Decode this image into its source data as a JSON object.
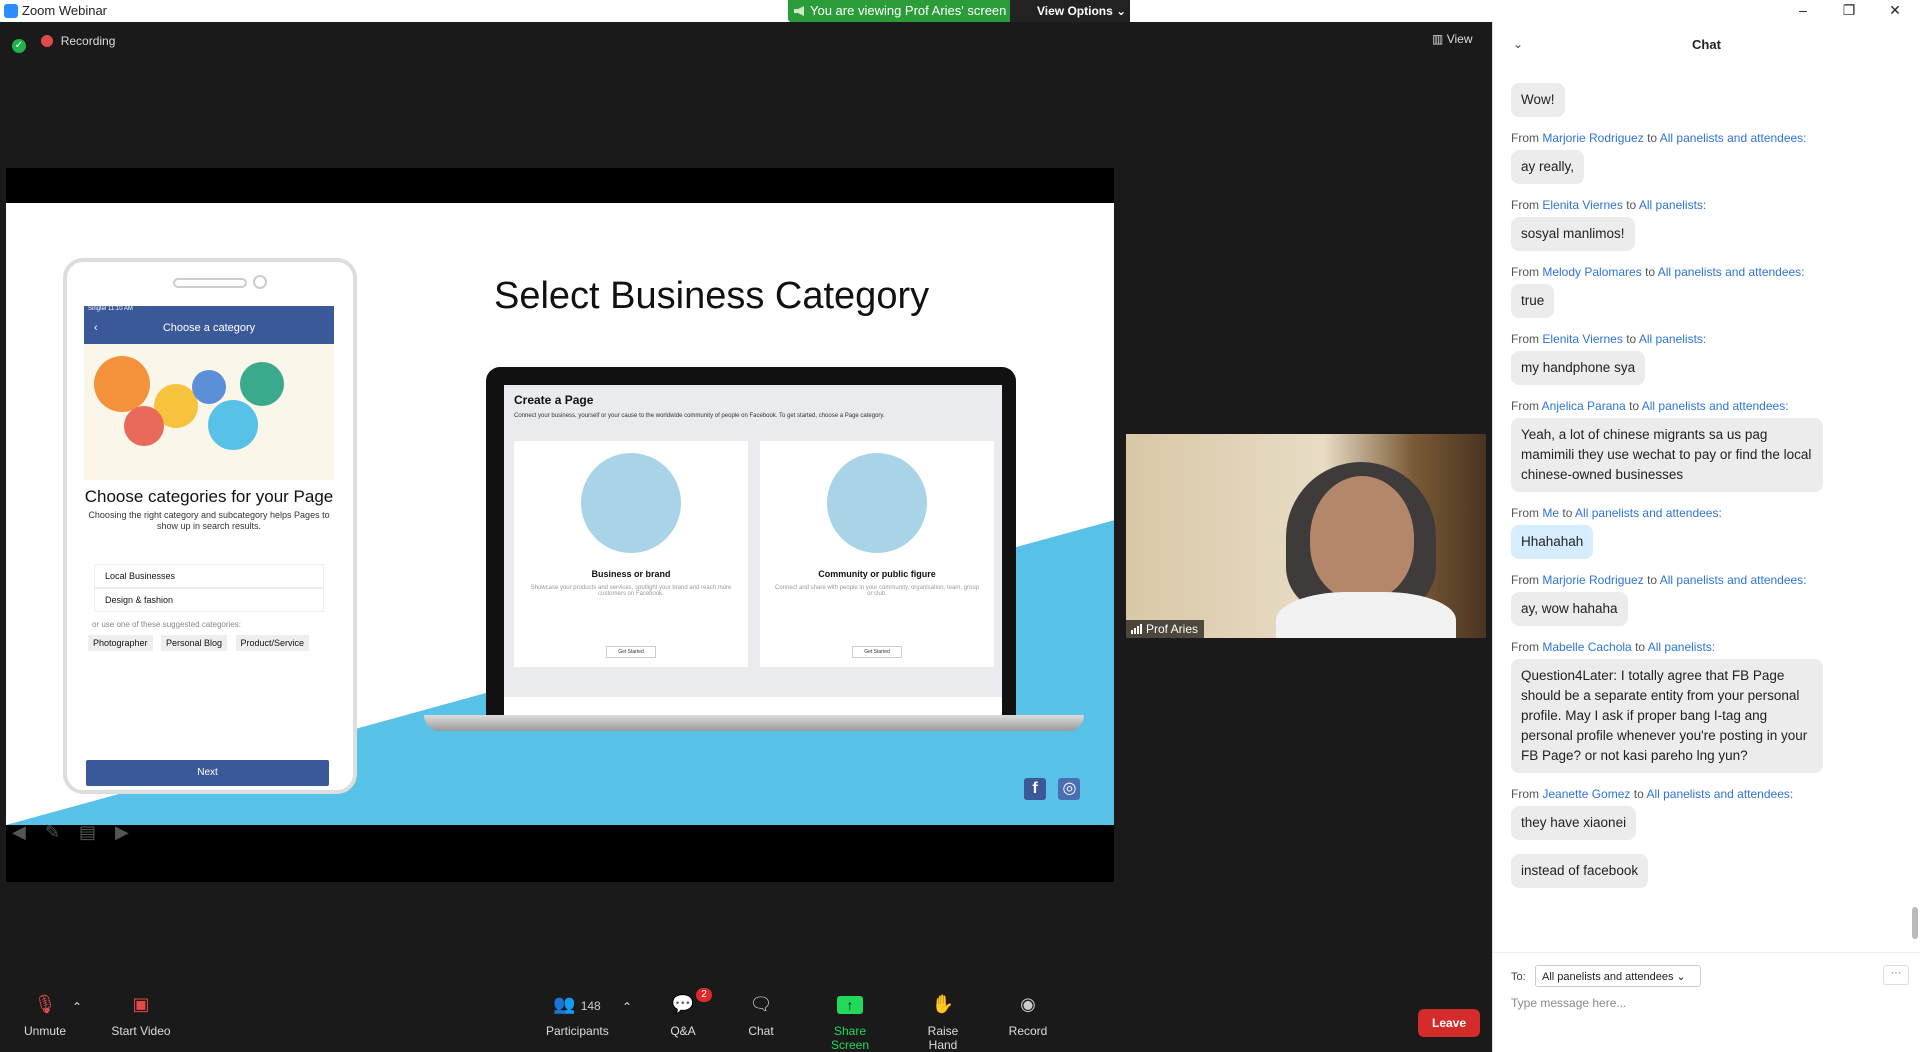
{
  "window": {
    "title": "Zoom Webinar",
    "viewing_banner": "You are viewing Prof Aries' screen",
    "view_options": "View Options",
    "minimize": "–",
    "maximize": "❐",
    "close": "✕"
  },
  "stage": {
    "recording": "Recording",
    "view": "View"
  },
  "slide": {
    "title": "Select Business Category",
    "phone": {
      "status": "Singtel 11:10 AM",
      "header": "Choose a category",
      "back": "‹",
      "heading": "Choose categories for your Page",
      "subtext": "Choosing the right category and subcategory helps Pages to show up in search results.",
      "options": [
        "Local Businesses",
        "Design & fashion"
      ],
      "suggest_label": "or use one of these suggested categories:",
      "chips": [
        "Photographer",
        "Personal Blog",
        "Product/Service"
      ],
      "next": "Next"
    },
    "laptop": {
      "title": "Create a Page",
      "subtitle": "Connect your business, yourself or your cause to the worldwide community of people on Facebook. To get started, choose a Page category.",
      "cards": [
        {
          "title": "Business or brand",
          "desc": "Showcase your products and services, spotlight your brand and reach more customers on Facebook.",
          "button": "Get Started"
        },
        {
          "title": "Community or public figure",
          "desc": "Connect and share with people in your community, organisation, team, group or club.",
          "button": "Get Started"
        }
      ]
    },
    "social": [
      "f",
      "◎"
    ]
  },
  "video": {
    "name": "Prof Aries"
  },
  "toolbar": {
    "unmute": "Unmute",
    "start_video": "Start Video",
    "participants_count": "148",
    "participants": "Participants",
    "qa_badge": "2",
    "qa": "Q&A",
    "chat": "Chat",
    "share_screen": "Share Screen",
    "raise_hand": "Raise Hand",
    "record": "Record",
    "leave": "Leave"
  },
  "chat": {
    "title": "Chat",
    "messages": [
      {
        "text": "Wow!"
      },
      {
        "from": "Marjorie Rodriguez",
        "to_word": "to",
        "to": "All panelists and attendees:",
        "text": "ay really,"
      },
      {
        "from": "Elenita Viernes",
        "to_word": "to",
        "to": "All panelists:",
        "text": "sosyal manlimos!"
      },
      {
        "from": "Melody Palomares",
        "to_word": "to",
        "to": "All panelists and attendees:",
        "text": "true"
      },
      {
        "from": "Elenita Viernes",
        "to_word": "to",
        "to": "All panelists:",
        "text": "my handphone sya"
      },
      {
        "from": "Anjelica Parana",
        "to_word": "to",
        "to": "All panelists and attendees:",
        "text": "Yeah, a lot of chinese migrants sa us pag mamimili they use wechat to pay or find the local chinese-owned businesses"
      },
      {
        "from": "Me",
        "to_word": "to",
        "to": "All panelists and attendees:",
        "text": "Hhahahah"
      },
      {
        "from": "Marjorie Rodriguez",
        "to_word": "to",
        "to": "All panelists and attendees:",
        "text": "ay, wow hahaha"
      },
      {
        "from": "Mabelle Cachola",
        "to_word": "to",
        "to": "All panelists:",
        "text": "Question4Later: I totally agree that FB Page should be a separate entity from your personal profile.  May I ask if proper bang I-tag ang personal profile whenever you're posting in your FB Page? or not kasi pareho lng yun?"
      },
      {
        "from": "Jeanette Gomez",
        "to_word": "to",
        "to": "All panelists and attendees:",
        "text": "they have xiaonei"
      },
      {
        "text": "instead of facebook"
      }
    ],
    "to_label": "To:",
    "to_select": "All panelists and attendees",
    "more": "···",
    "placeholder": "Type message here..."
  }
}
